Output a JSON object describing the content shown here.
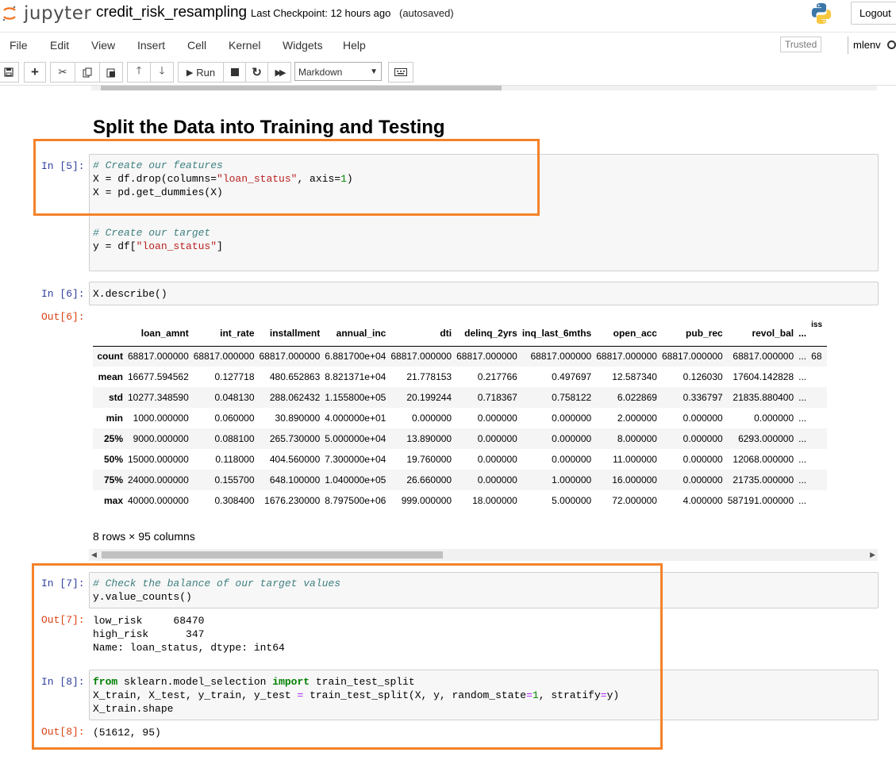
{
  "header": {
    "logo_text": "jupyter",
    "notebook_name": "credit_risk_resampling",
    "checkpoint": "Last Checkpoint: 12 hours ago",
    "autosave": "(autosaved)",
    "logout": "Logout"
  },
  "menu": {
    "items": [
      "File",
      "Edit",
      "View",
      "Insert",
      "Cell",
      "Kernel",
      "Widgets",
      "Help"
    ],
    "trusted": "Trusted",
    "kernel": "mlenv"
  },
  "toolbar": {
    "run_label": "Run",
    "cell_type": "Markdown"
  },
  "heading": "Split the Data into Training and Testing",
  "cells": {
    "c5": {
      "prompt": "In [5]:",
      "lines": [
        [
          [
            "cm",
            "# Create our features"
          ]
        ],
        [
          [
            "",
            "X = df.drop(columns="
          ],
          [
            "st",
            "\"loan_status\""
          ],
          [
            "",
            ", axis="
          ],
          [
            "nm",
            "1"
          ],
          [
            "",
            ")"
          ]
        ],
        [
          [
            "",
            "X = pd.get_dummies(X)"
          ]
        ],
        [
          [
            "",
            ""
          ]
        ],
        [
          [
            "",
            ""
          ]
        ],
        [
          [
            "cm",
            "# Create our target"
          ]
        ],
        [
          [
            "",
            "y = df["
          ],
          [
            "st",
            "\"loan_status\""
          ],
          [
            "",
            "]"
          ]
        ]
      ]
    },
    "c6": {
      "prompt": "In [6]:",
      "code": "X.describe()",
      "out_prompt": "Out[6]:",
      "table": {
        "columns": [
          "",
          "loan_amnt",
          "int_rate",
          "installment",
          "annual_inc",
          "dti",
          "delinq_2yrs",
          "inq_last_6mths",
          "open_acc",
          "pub_rec",
          "revol_bal",
          "...",
          "iss"
        ],
        "rows": [
          [
            "count",
            "68817.000000",
            "68817.000000",
            "68817.000000",
            "6.881700e+04",
            "68817.000000",
            "68817.000000",
            "68817.000000",
            "68817.000000",
            "68817.000000",
            "68817.000000",
            "...",
            "68"
          ],
          [
            "mean",
            "16677.594562",
            "0.127718",
            "480.652863",
            "8.821371e+04",
            "21.778153",
            "0.217766",
            "0.497697",
            "12.587340",
            "0.126030",
            "17604.142828",
            "...",
            ""
          ],
          [
            "std",
            "10277.348590",
            "0.048130",
            "288.062432",
            "1.155800e+05",
            "20.199244",
            "0.718367",
            "0.758122",
            "6.022869",
            "0.336797",
            "21835.880400",
            "...",
            ""
          ],
          [
            "min",
            "1000.000000",
            "0.060000",
            "30.890000",
            "4.000000e+01",
            "0.000000",
            "0.000000",
            "0.000000",
            "2.000000",
            "0.000000",
            "0.000000",
            "...",
            ""
          ],
          [
            "25%",
            "9000.000000",
            "0.088100",
            "265.730000",
            "5.000000e+04",
            "13.890000",
            "0.000000",
            "0.000000",
            "8.000000",
            "0.000000",
            "6293.000000",
            "...",
            ""
          ],
          [
            "50%",
            "15000.000000",
            "0.118000",
            "404.560000",
            "7.300000e+04",
            "19.760000",
            "0.000000",
            "0.000000",
            "11.000000",
            "0.000000",
            "12068.000000",
            "...",
            ""
          ],
          [
            "75%",
            "24000.000000",
            "0.155700",
            "648.100000",
            "1.040000e+05",
            "26.660000",
            "0.000000",
            "1.000000",
            "16.000000",
            "0.000000",
            "21735.000000",
            "...",
            ""
          ],
          [
            "max",
            "40000.000000",
            "0.308400",
            "1676.230000",
            "8.797500e+06",
            "999.000000",
            "18.000000",
            "5.000000",
            "72.000000",
            "4.000000",
            "587191.000000",
            "...",
            ""
          ]
        ],
        "summary": "8 rows × 95 columns"
      }
    },
    "c7": {
      "prompt": "In [7]:",
      "lines": [
        [
          [
            "cm",
            "# Check the balance of our target values"
          ]
        ],
        [
          [
            "",
            "y.value_counts()"
          ]
        ]
      ],
      "out_prompt": "Out[7]:",
      "output": "low_risk     68470\nhigh_risk      347\nName: loan_status, dtype: int64"
    },
    "c8": {
      "prompt": "In [8]:",
      "lines": [
        [
          [
            "kw",
            "from"
          ],
          [
            "",
            " sklearn.model_selection "
          ],
          [
            "kw",
            "import"
          ],
          [
            "",
            " train_test_split"
          ]
        ],
        [
          [
            "",
            "X_train, X_test, y_train, y_test "
          ],
          [
            "op",
            "="
          ],
          [
            "",
            " train_test_split(X, y, random_state"
          ],
          [
            "op",
            "="
          ],
          [
            "nm",
            "1"
          ],
          [
            "",
            ", stratify"
          ],
          [
            "op",
            "="
          ],
          [
            "",
            "y)"
          ]
        ],
        [
          [
            "",
            "X_train.shape"
          ]
        ]
      ],
      "out_prompt": "Out[8]:",
      "output": "(51612, 95)"
    }
  },
  "colors": {
    "highlight": "#f4822a",
    "in_prompt": "#303f9f",
    "out_prompt": "#d84315"
  }
}
